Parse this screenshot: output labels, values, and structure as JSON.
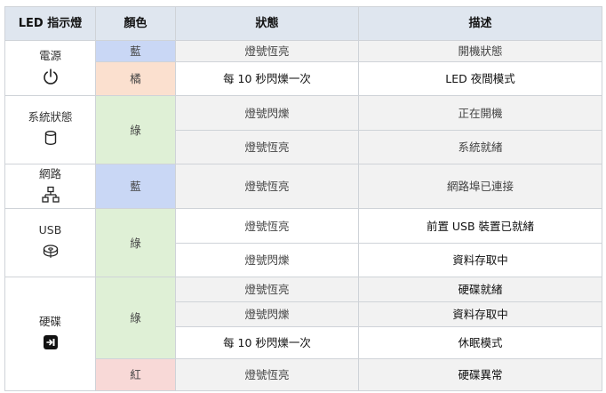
{
  "header": {
    "led": "LED 指示燈",
    "color": "顏色",
    "status": "狀態",
    "description": "描述"
  },
  "groups": {
    "power": {
      "name": "電源",
      "icon": "power-icon",
      "rows": [
        {
          "color": "藍",
          "status": "燈號恆亮",
          "description": "開機狀態"
        },
        {
          "color": "橘",
          "status": "每 10 秒閃爍一次",
          "description": "LED 夜間模式"
        }
      ]
    },
    "system": {
      "name": "系統狀態",
      "icon": "database-icon",
      "color": "綠",
      "rows": [
        {
          "status": "燈號閃爍",
          "description": "正在開機"
        },
        {
          "status": "燈號恆亮",
          "description": "系統就緒"
        }
      ]
    },
    "network": {
      "name": "網路",
      "icon": "network-icon",
      "rows": [
        {
          "color": "藍",
          "status": "燈號恆亮",
          "description": "網路埠已連接"
        }
      ]
    },
    "usb": {
      "name": "USB",
      "icon": "usb-disk-icon",
      "color": "綠",
      "rows": [
        {
          "status": "燈號恆亮",
          "description": "前置 USB 裝置已就緒"
        },
        {
          "status": "燈號閃爍",
          "description": "資料存取中"
        }
      ]
    },
    "hdd": {
      "name": "硬碟",
      "icon": "hard-drive-icon",
      "color_green": "綠",
      "color_red": "紅",
      "rows": [
        {
          "status": "燈號恆亮",
          "description": "硬碟就緒"
        },
        {
          "status": "燈號閃爍",
          "description": "資料存取中"
        },
        {
          "status": "每 10 秒閃爍一次",
          "description": "休眠模式"
        },
        {
          "status": "燈號恆亮",
          "description": "硬碟異常"
        }
      ]
    }
  },
  "colors": {
    "blue": "#c9d7f5",
    "orange": "#fbe0cf",
    "green": "#dff0d6",
    "red": "#f8d9d7",
    "header": "#dfe6ef"
  }
}
